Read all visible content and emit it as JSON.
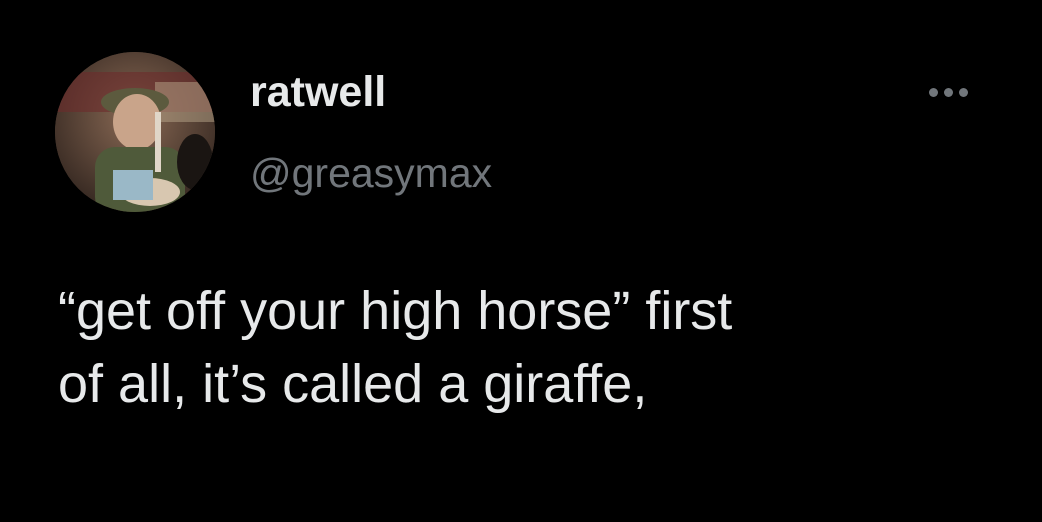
{
  "tweet": {
    "author": {
      "display_name": "ratwell",
      "handle": "@greasymax",
      "avatar_icon": "profile-photo"
    },
    "more_icon": "more-horizontal-icon",
    "text_line_1": "“get off your high horse” first",
    "text_line_2": "of all, it’s called a giraffe,"
  },
  "colors": {
    "background": "#000000",
    "primary_text": "#e7e9ea",
    "secondary_text": "#71767b"
  }
}
